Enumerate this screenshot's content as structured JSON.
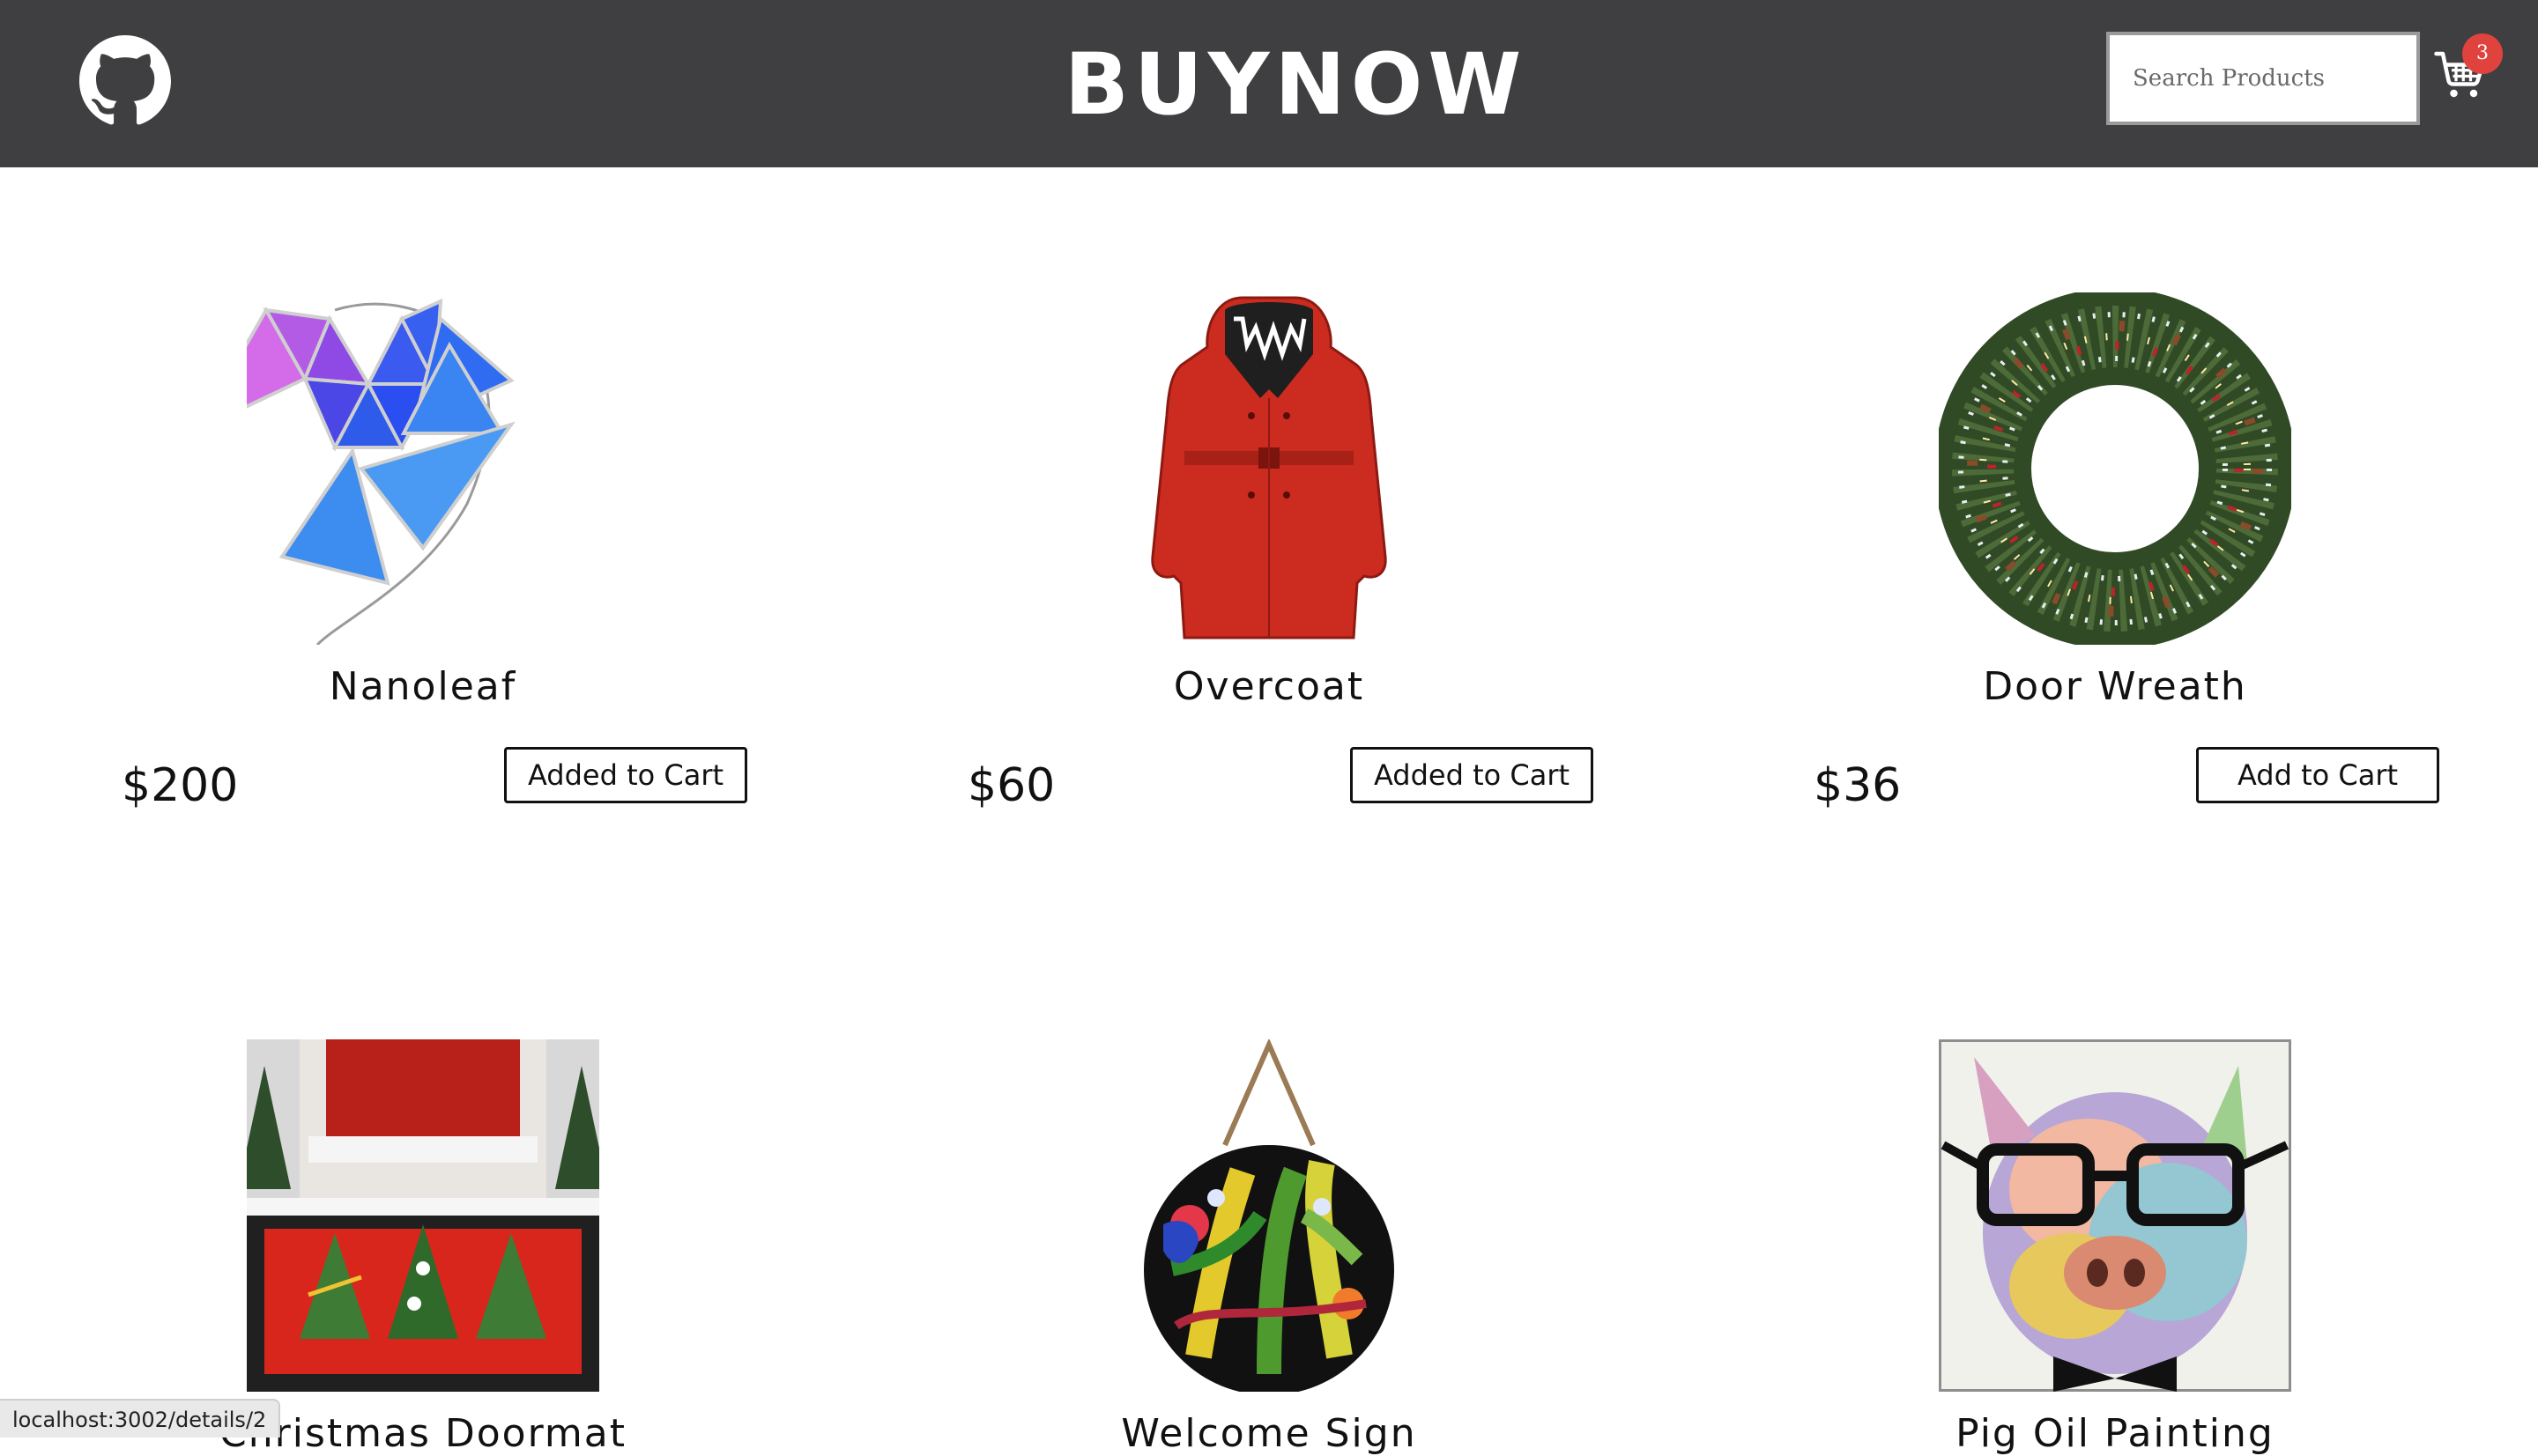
{
  "header": {
    "brand": "BUYNOW",
    "search_placeholder": "Search Products",
    "cart_count": "3",
    "background": "#3f3f41"
  },
  "products": [
    {
      "name": "Nanoleaf",
      "price": "$200",
      "button": "Added to Cart"
    },
    {
      "name": "Overcoat",
      "price": "$60",
      "button": "Added to Cart"
    },
    {
      "name": "Door Wreath",
      "price": "$36",
      "button": "Add to Cart"
    },
    {
      "name": "Christmas Doormat"
    },
    {
      "name": "Welcome Sign"
    },
    {
      "name": "Pig Oil Painting"
    }
  ],
  "status_bar": {
    "url": "localhost:3002/details/2"
  },
  "colors": {
    "badge": "#e0433d",
    "text": "#111111"
  }
}
